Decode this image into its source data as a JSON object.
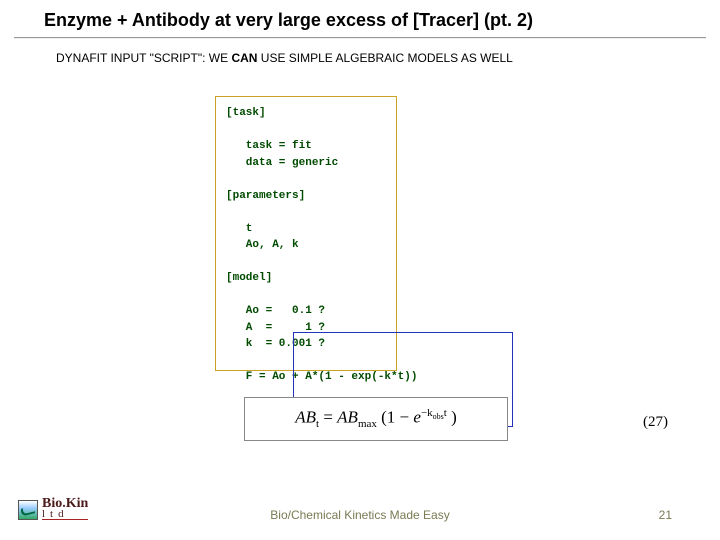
{
  "title": "Enzyme + Antibody at very large excess of [Tracer] (pt. 2)",
  "subtitle_pre": "DYNAFIT INPUT \"SCRIPT\": WE ",
  "subtitle_bold": "CAN",
  "subtitle_post": " USE SIMPLE ALGEBRAIC MODELS AS WELL",
  "code": "[task]\n\n   task = fit\n   data = generic\n\n[parameters]\n\n   t\n   Ao, A, k\n\n[model]\n\n   Ao =   0.1 ?\n   A  =     1 ?\n   k  = 0.001 ?\n\n   F = Ao + A*(1 - exp(-k*t))",
  "equation": {
    "lhs_base": "AB",
    "lhs_sub": "t",
    "eq": " = ",
    "rhs_a_base": "AB",
    "rhs_a_sub": "max",
    "rhs_open": "(1 − ",
    "rhs_e": "e",
    "rhs_exp": "−k",
    "rhs_exp_sub": "obs",
    "rhs_exp_tail": "t",
    "rhs_close": ")"
  },
  "eqnum": "(27)",
  "footer": "Bio/Chemical Kinetics Made Easy",
  "page": "21",
  "logo": {
    "line1": "Bio.Kin",
    "line2": "ltd"
  }
}
